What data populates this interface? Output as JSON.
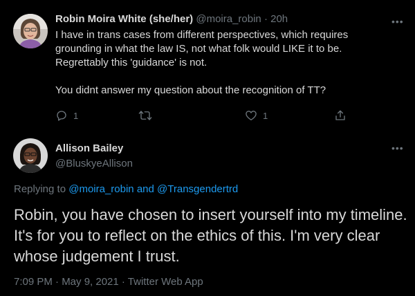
{
  "tweet1": {
    "display_name": "Robin Moira White (she/her)",
    "handle": "@moira_robin",
    "separator": "·",
    "time": "20h",
    "lines": [
      "I have in trans cases from different perspectives, which requires",
      "grounding in what the law IS, not what folk would LIKE it to be.",
      "Regrettably this 'guidance' is not."
    ],
    "question": "You didnt answer my question about the recognition of TT?",
    "more_icon": "more-horizontal-icon",
    "actions": {
      "reply_count": "1",
      "retweet_count": "",
      "like_count": "1",
      "reply_icon": "reply-icon",
      "retweet_icon": "retweet-icon",
      "like_icon": "heart-icon",
      "share_icon": "share-icon"
    }
  },
  "tweet2": {
    "display_name": "Allison Bailey",
    "handle": "@BluskyeAllison",
    "more_icon": "more-horizontal-icon",
    "replying_prefix": "Replying to",
    "replying_to_1": "@moira_robin",
    "replying_and": "and",
    "replying_to_2": "@Transgendertrd",
    "text": "Robin, you have chosen to insert yourself into my timeline. It's for you to reflect on the ethics of this. I'm very clear whose judgement I trust.",
    "timestamp": "7:09 PM · May 9, 2021 · Twitter Web App"
  },
  "colors": {
    "background": "#000000",
    "text": "#d9d9d9",
    "muted": "#6e767d",
    "link": "#1d9bf0"
  }
}
